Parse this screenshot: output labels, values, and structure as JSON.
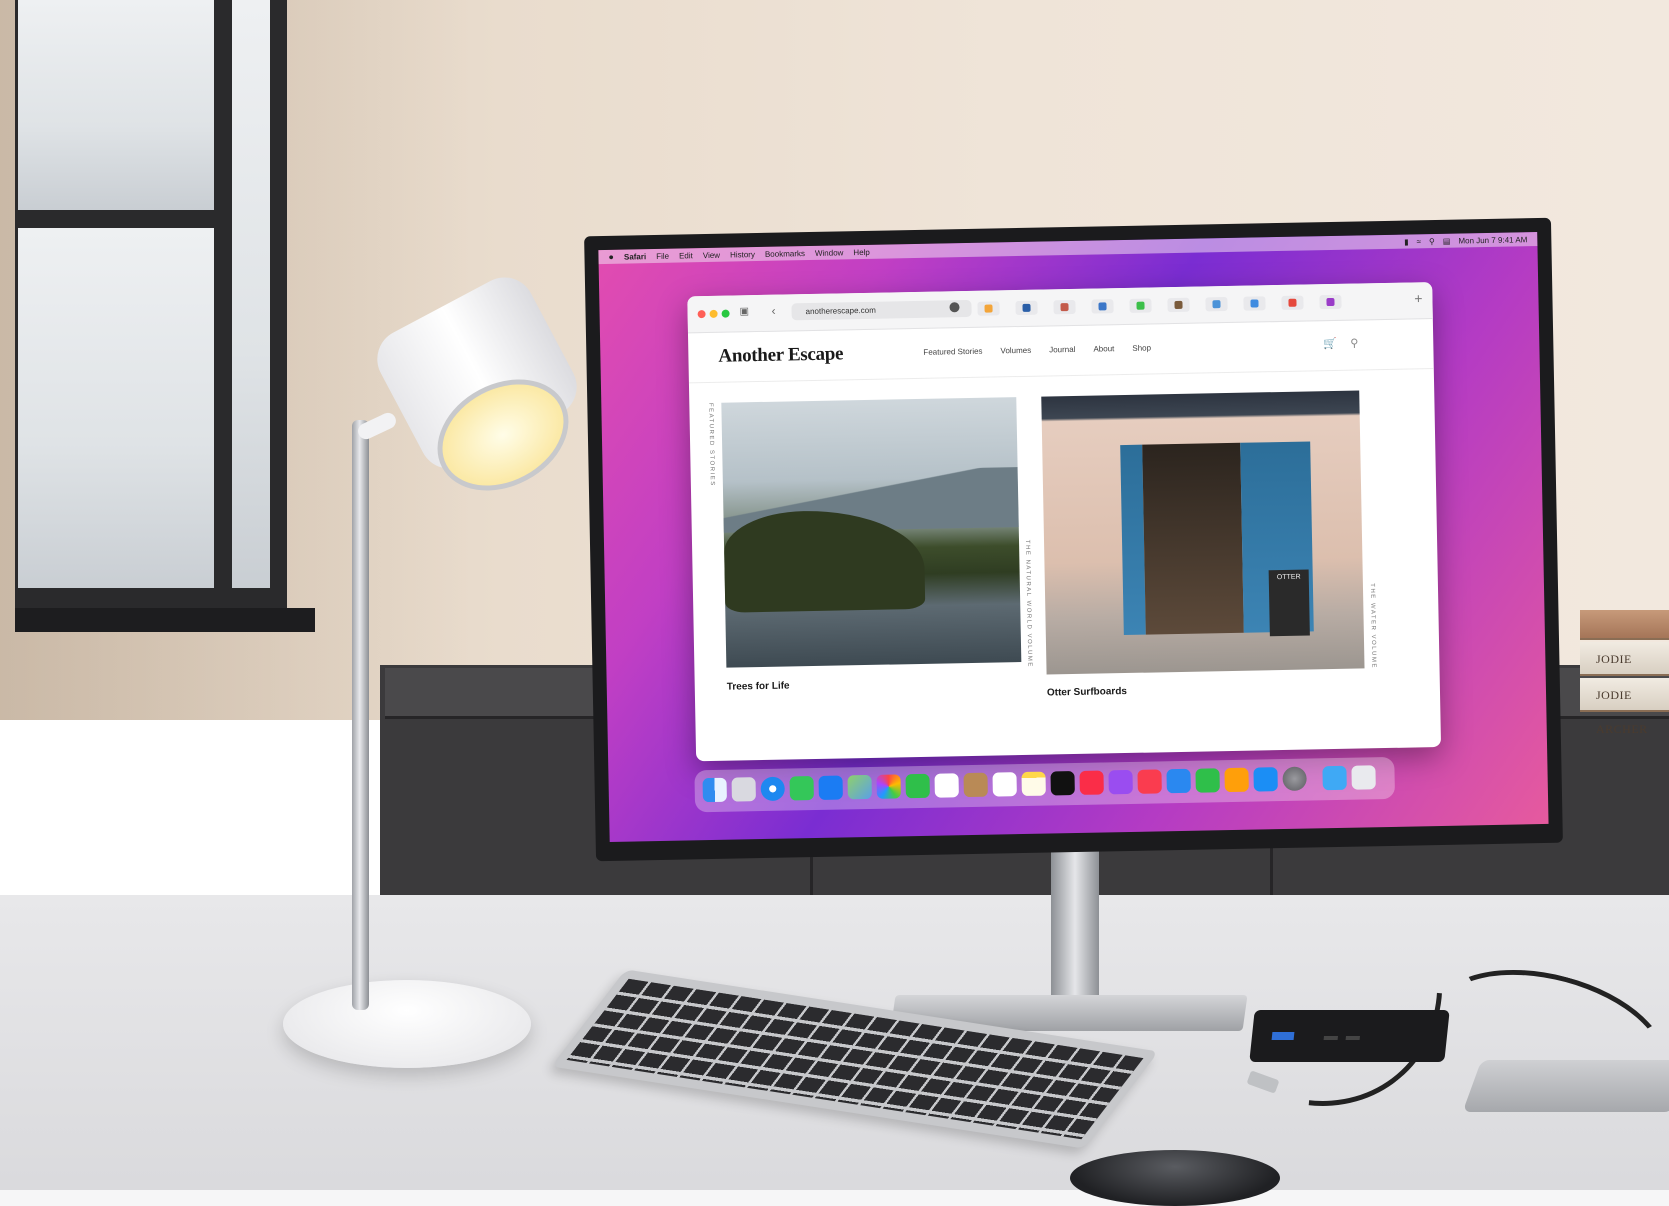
{
  "menubar": {
    "apple": "",
    "app": "Safari",
    "items": [
      "File",
      "Edit",
      "View",
      "History",
      "Bookmarks",
      "Window",
      "Help"
    ],
    "clock": "Mon Jun 7  9:41 AM"
  },
  "browser": {
    "url": "anotherescape.com"
  },
  "site": {
    "logo": "Another Escape",
    "nav": [
      "Featured Stories",
      "Volumes",
      "Journal",
      "About",
      "Shop"
    ],
    "featured_label": "FEATURED STORIES",
    "stories": [
      {
        "caption": "Trees for Life",
        "volume_label": "THE NATURAL WORLD VOLUME"
      },
      {
        "caption": "Otter Surfboards",
        "volume_label": "THE WATER VOLUME"
      }
    ],
    "shop_sign": "OTTER"
  },
  "books": [
    "JODIE ARCHER",
    "JODIE ARCHER"
  ],
  "colors": {
    "wallpaper_start": "#e24cb0",
    "wallpaper_mid": "#7a2dd2",
    "dot_red": "#ff5f57",
    "dot_yellow": "#febc2e",
    "dot_green": "#28c840"
  },
  "dock_icons": [
    "finder-icon",
    "launchpad-icon",
    "safari-icon",
    "messages-icon",
    "mail-icon",
    "maps-icon",
    "photos-icon",
    "facetime-icon",
    "calendar-icon",
    "contacts-icon",
    "reminders-icon",
    "notes-icon",
    "tv-icon",
    "music-icon",
    "podcasts-icon",
    "news-icon",
    "keynote-icon",
    "numbers-icon",
    "pages-icon",
    "app-store-icon",
    "system-preferences-icon",
    "downloads-folder-icon",
    "trash-icon"
  ]
}
